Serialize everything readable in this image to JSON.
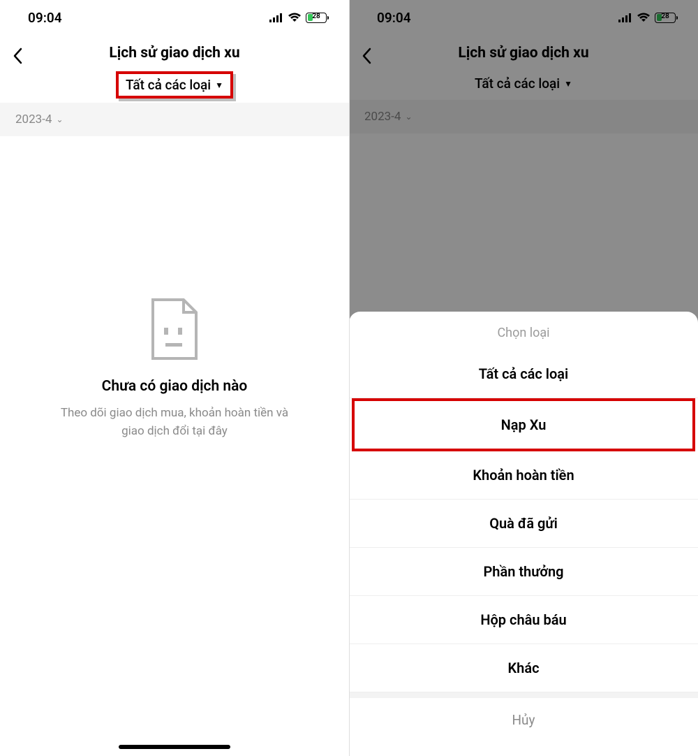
{
  "status": {
    "time": "09:04",
    "battery": "28"
  },
  "left": {
    "title": "Lịch sử giao dịch xu",
    "filter_label": "Tất cả các loại",
    "date": "2023-4",
    "empty_title": "Chưa có giao dịch nào",
    "empty_sub": "Theo dõi giao dịch mua, khoản hoàn tiền và giao dịch đổi tại đây"
  },
  "right": {
    "title": "Lịch sử giao dịch xu",
    "filter_label": "Tất cả các loại",
    "date": "2023-4",
    "sheet_title": "Chọn loại",
    "options": [
      "Tất cả các loại",
      "Nạp Xu",
      "Khoản hoàn tiền",
      "Quà đã gửi",
      "Phần thưởng",
      "Hộp châu báu",
      "Khác"
    ],
    "cancel": "Hủy"
  }
}
